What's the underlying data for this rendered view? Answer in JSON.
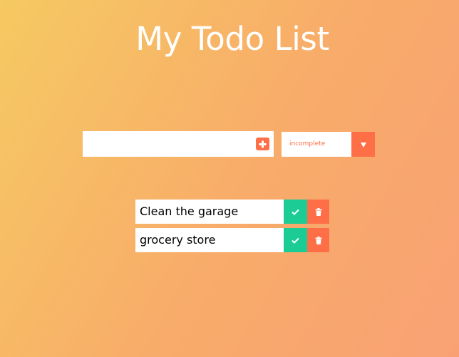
{
  "header": {
    "title": "My Todo List"
  },
  "form": {
    "input_value": "",
    "input_placeholder": "",
    "add_icon": "plus-square-icon",
    "filter_selected": "incomplete",
    "filter_icon": "caret-down-icon"
  },
  "todos": [
    {
      "text": "Clean the garage",
      "complete_icon": "check-icon",
      "delete_icon": "trash-icon"
    },
    {
      "text": "grocery store",
      "complete_icon": "check-icon",
      "delete_icon": "trash-icon"
    }
  ],
  "colors": {
    "accent": "#ff6f47",
    "complete": "#1ccc95",
    "gradient_start": "#f6c962",
    "gradient_end": "#f9a174"
  }
}
